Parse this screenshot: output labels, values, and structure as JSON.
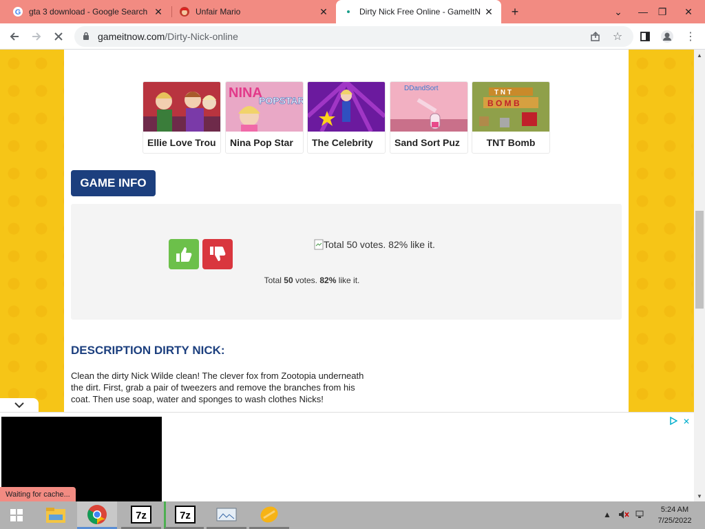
{
  "browser": {
    "tabs": [
      {
        "title": "gta 3 download - Google Search",
        "icon": "google-icon",
        "active": false
      },
      {
        "title": "Unfair Mario",
        "icon": "mario-icon",
        "active": false
      },
      {
        "title": "Dirty Nick Free Online - GameItN",
        "icon": "loading-icon",
        "active": true
      }
    ],
    "new_tab_symbol": "+",
    "url_host": "gameitnow.com",
    "url_path": "/Dirty-Nick-online"
  },
  "page": {
    "related_games": [
      {
        "name": "Ellie Love Trou",
        "thumb_color": "#b8343f"
      },
      {
        "name": "Nina Pop Star",
        "thumb_color": "#e48bb0"
      },
      {
        "name": "The Celebrity",
        "thumb_color": "#7b1ba8"
      },
      {
        "name": "Sand Sort Puz",
        "thumb_color": "#f0a6b8"
      },
      {
        "name": "TNT Bomb",
        "thumb_color": "#9aa84a"
      }
    ],
    "game_info_label": "GAME INFO",
    "vote_image_alt": "Total 50 votes. 82% like it.",
    "votes": {
      "prefix": "Total ",
      "count": "50",
      "middle": " votes. ",
      "percent": "82%",
      "suffix": " like it."
    },
    "description_title": "DESCRIPTION DIRTY NICK:",
    "description_body": "Clean the dirty Nick Wilde clean! The clever fox from Zootopia underneath the dirt. First, grab a pair of tweezers and remove the branches from his coat. Then use soap, water and sponges to wash clothes Nicks!"
  },
  "status_bar": "Waiting for cache...",
  "taskbar": {
    "time": "5:24 AM",
    "date": "7/25/2022",
    "apps": [
      "windows-start",
      "file-explorer",
      "chrome",
      "7zip",
      "7zip",
      "screenshot-tool",
      "orange-app"
    ]
  }
}
